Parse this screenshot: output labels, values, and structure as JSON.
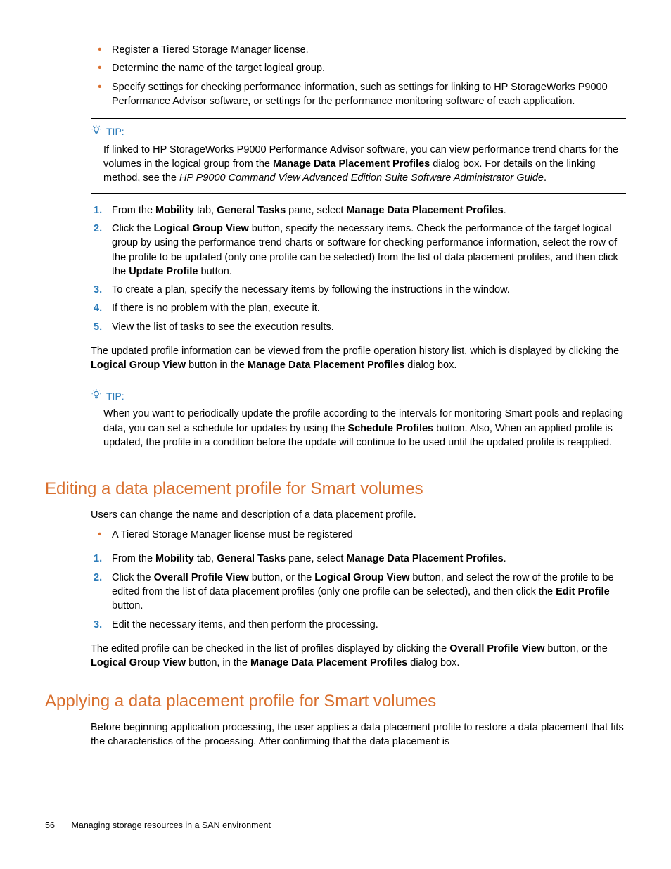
{
  "intro_bullets": [
    "Register a Tiered Storage Manager license.",
    "Determine the name of the target logical group.",
    "Specify settings for checking performance information, such as settings for linking to HP StorageWorks P9000 Performance Advisor software, or settings for the performance monitoring software of each application."
  ],
  "tip1": {
    "label": "TIP:",
    "body_pre": "If linked to HP StorageWorks P9000 Performance Advisor software, you can view performance trend charts for the volumes in the logical group from the ",
    "bold1": "Manage Data Placement Profiles",
    "body_mid": " dialog box. For details on the linking method, see the ",
    "italic1": "HP P9000 Command View Advanced Edition Suite Software Administrator Guide",
    "body_end": "."
  },
  "steps1": {
    "s1": {
      "pre": "From the ",
      "b1": "Mobility",
      "mid1": " tab, ",
      "b2": "General Tasks",
      "mid2": " pane, select ",
      "b3": "Manage Data Placement Profiles",
      "end": "."
    },
    "s2": {
      "pre": "Click the ",
      "b1": "Logical Group View",
      "mid1": " button, specify the necessary items. Check the performance of the target logical group by using the performance trend charts or software for checking performance information, select the row of the profile to be updated (only one profile can be selected) from the list of data placement profiles, and then click the ",
      "b2": "Update Profile",
      "end": " button."
    },
    "s3": "To create a plan, specify the necessary items by following the instructions in the window.",
    "s4": "If there is no problem with the plan, execute it.",
    "s5": "View the list of tasks to see the execution results."
  },
  "post1": {
    "pre": "The updated profile information can be viewed from the profile operation history list, which is displayed by clicking the ",
    "b1": "Logical Group View",
    "mid": " button in the ",
    "b2": "Manage Data Placement Profiles",
    "end": " dialog box."
  },
  "tip2": {
    "label": "TIP:",
    "pre": "When you want to periodically update the profile according to the intervals for monitoring Smart pools and replacing data, you can set a schedule for updates by using the ",
    "b1": "Schedule Profiles",
    "end": " button. Also, When an applied profile is updated, the profile in a condition before the update will continue to be used until the updated profile is reapplied."
  },
  "section_edit": {
    "title": "Editing a data placement profile for Smart volumes",
    "intro": "Users can change the name and description of a data placement profile.",
    "bullet1": "A Tiered Storage Manager license must be registered",
    "s1": {
      "pre": "From the ",
      "b1": "Mobility",
      "mid1": " tab, ",
      "b2": "General Tasks",
      "mid2": " pane, select ",
      "b3": "Manage Data Placement Profiles",
      "end": "."
    },
    "s2": {
      "pre": "Click the ",
      "b1": "Overall Profile View",
      "mid1": " button, or the ",
      "b2": "Logical Group View",
      "mid2": " button, and select the row of the profile to be edited from the list of data placement profiles (only one profile can be selected), and then click the ",
      "b3": "Edit Profile",
      "end": " button."
    },
    "s3": "Edit the necessary items, and then perform the processing.",
    "post": {
      "pre": "The edited profile can be checked in the list of profiles displayed by clicking the ",
      "b1": "Overall Profile View",
      "mid1": " button, or the ",
      "b2": "Logical Group View",
      "mid2": " button, in the ",
      "b3": "Manage Data Placement Profiles",
      "end": " dialog box."
    }
  },
  "section_apply": {
    "title": "Applying a data placement profile for Smart volumes",
    "intro": "Before beginning application processing, the user applies a data placement profile to restore a data placement that fits the characteristics of the processing. After confirming that the data placement is"
  },
  "footer": {
    "page": "56",
    "title": "Managing storage resources in a SAN environment"
  }
}
